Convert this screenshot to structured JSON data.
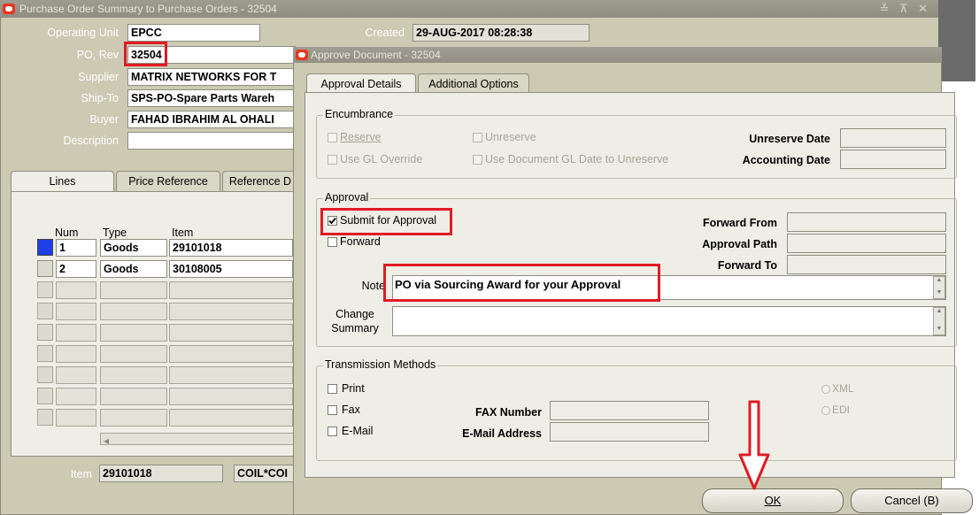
{
  "bg_window": {
    "title": "Purchase Order Summary to Purchase Orders - 32504",
    "controls": "≚ ⊼ ✕",
    "fields": {
      "operating_unit_label": "Operating Unit",
      "operating_unit": "EPCC",
      "created_label": "Created",
      "created": "29-AUG-2017 08:28:38",
      "po_rev_label": "PO, Rev",
      "po_rev": "32504",
      "supplier_label": "Supplier",
      "supplier": "MATRIX NETWORKS FOR T",
      "ship_to_label": "Ship-To",
      "ship_to": "SPS-PO-Spare Parts Wareh",
      "buyer_label": "Buyer",
      "buyer": "FAHAD IBRAHIM AL OHALI",
      "description_label": "Description",
      "description": ""
    },
    "tabs": [
      "Lines",
      "Price Reference",
      "Reference D"
    ],
    "lines_table": {
      "headers": [
        "Num",
        "Type",
        "Item"
      ],
      "rows": [
        {
          "num": "1",
          "type": "Goods",
          "item": "29101018"
        },
        {
          "num": "2",
          "type": "Goods",
          "item": "30108005"
        }
      ]
    },
    "item_label": "Item",
    "item_value": "29101018",
    "item_desc": "COIL*COI"
  },
  "dialog": {
    "title": "Approve Document - 32504",
    "tabs": [
      "Approval Details",
      "Additional Options"
    ],
    "encumbrance": {
      "title": "Encumbrance",
      "reserve": "Reserve",
      "unreserve": "Unreserve",
      "use_gl_override": "Use GL Override",
      "use_doc_gl_date": "Use Document GL Date to Unreserve",
      "unreserve_date_label": "Unreserve Date",
      "accounting_date_label": "Accounting Date"
    },
    "approval": {
      "title": "Approval",
      "submit_for_approval": "Submit for Approval",
      "submit_checked": true,
      "forward": "Forward",
      "forward_from_label": "Forward From",
      "approval_path_label": "Approval Path",
      "forward_to_label": "Forward To",
      "note_label": "Note",
      "note_value": "PO via Sourcing Award for your Approval",
      "change_summary_label": "Change Summary"
    },
    "transmission": {
      "title": "Transmission Methods",
      "print": "Print",
      "fax": "Fax",
      "email": "E-Mail",
      "fax_number_label": "FAX Number",
      "email_address_label": "E-Mail Address",
      "xml": "XML",
      "edi": "EDI"
    },
    "ok_button": "OK",
    "cancel_button": "Cancel (B)"
  },
  "colors": {
    "highlight_red": "#e01b24",
    "oracle_red": "#e8351f"
  }
}
